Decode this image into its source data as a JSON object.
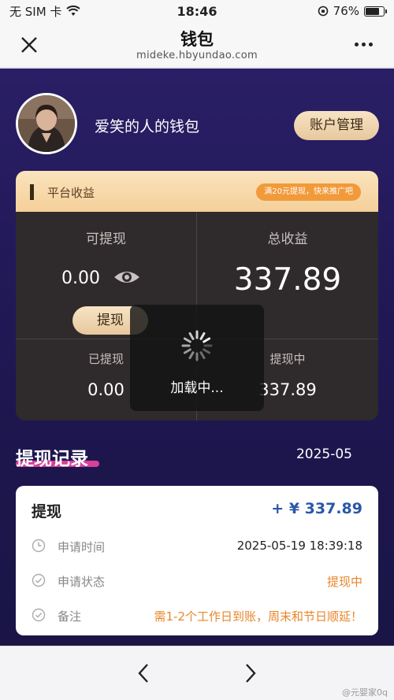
{
  "status_bar": {
    "carrier": "无 SIM 卡",
    "time": "18:46",
    "battery": "76%",
    "battery_level": 0.76
  },
  "nav": {
    "title": "钱包",
    "url": "mideke.hbyundao.com"
  },
  "wallet": {
    "name": "爱笑的人的钱包",
    "account_button": "账户管理"
  },
  "earnings": {
    "header_title": "平台收益",
    "promo": "满20元提现，快来推广吧",
    "withdrawable_label": "可提现",
    "withdrawable_value": "0.00",
    "total_label": "总收益",
    "total_value": "337.89",
    "withdraw_button": "提现",
    "withdrawn_label": "已提现",
    "withdrawn_value": "0.00",
    "pending_label": "提现中",
    "pending_value": "337.89"
  },
  "records": {
    "title": "提现记录",
    "period": "2025-05",
    "items": [
      {
        "type": "提现",
        "amount": "+ ¥ 337.89",
        "time_label": "申请时间",
        "time_value": "2025-05-19 18:39:18",
        "status_label": "申请状态",
        "status_value": "提现中",
        "note_label": "备注",
        "note_value": "需1-2个工作日到账，周末和节日顺延！"
      }
    ]
  },
  "loading": {
    "text": "加载中..."
  },
  "watermark": "@元婴家0q",
  "colors": {
    "header_purple": "#241a5c",
    "gold": "#f4d09a",
    "card_dark": "#2f2a2b",
    "amount_blue": "#2a57a8",
    "status_orange": "#e8862a",
    "underline_pink": "#d6419a"
  }
}
